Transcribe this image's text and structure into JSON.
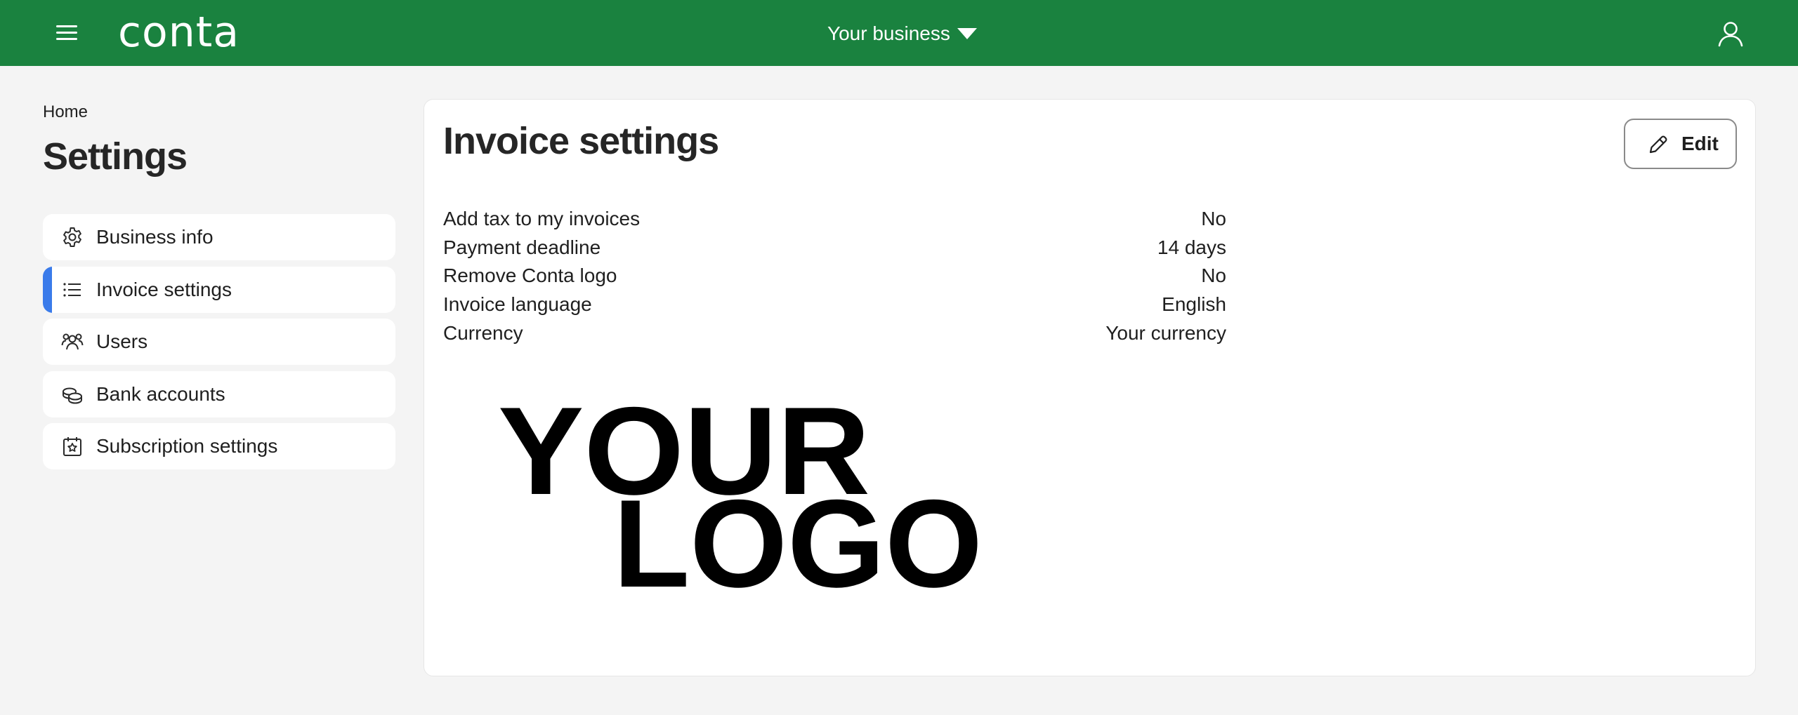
{
  "header": {
    "logo_text": "conta",
    "business_selector": "Your business",
    "icons": {
      "menu": "hamburger-menu-icon",
      "caret": "caret-down-icon",
      "user": "user-profile-icon"
    },
    "brand_color": "#1a823f"
  },
  "breadcrumb": {
    "home": "Home"
  },
  "page": {
    "title": "Settings"
  },
  "sidebar": {
    "accent_color": "#3a7bea",
    "items": [
      {
        "label": "Business info",
        "icon": "gear-icon",
        "active": false
      },
      {
        "label": "Invoice settings",
        "icon": "list-icon",
        "active": true
      },
      {
        "label": "Users",
        "icon": "users-icon",
        "active": false
      },
      {
        "label": "Bank accounts",
        "icon": "coins-icon",
        "active": false
      },
      {
        "label": "Subscription settings",
        "icon": "calendar-star-icon",
        "active": false
      }
    ]
  },
  "main": {
    "title": "Invoice settings",
    "edit_label": "Edit",
    "edit_icon": "pencil-icon",
    "settings": [
      {
        "label": "Add tax to my invoices",
        "value": "No"
      },
      {
        "label": "Payment deadline",
        "value": "14 days"
      },
      {
        "label": "Remove Conta logo",
        "value": "No"
      },
      {
        "label": "Invoice language",
        "value": "English"
      },
      {
        "label": "Currency",
        "value": "Your currency"
      }
    ],
    "logo_preview": {
      "line1": "YOUR",
      "line2": "LOGO"
    }
  }
}
